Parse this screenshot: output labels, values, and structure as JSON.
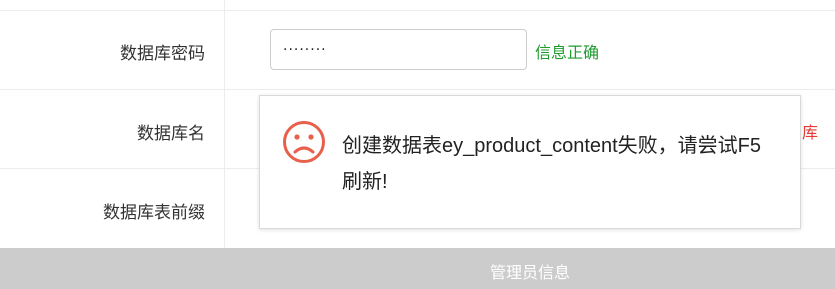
{
  "form": {
    "password_label": "数据库密码",
    "password_value": "········",
    "password_status": "信息正确",
    "dbname_label": "数据库名",
    "dbname_status": "库",
    "prefix_label": "数据库表前缀"
  },
  "section": {
    "title": "管理员信息"
  },
  "dialog": {
    "icon": "sad-face-icon",
    "message": "创建数据表ey_product_content失败，请尝试F5刷新!"
  },
  "colors": {
    "ok": "#1e9c2e",
    "error": "#e53935",
    "section_bar": "#cccccc"
  }
}
